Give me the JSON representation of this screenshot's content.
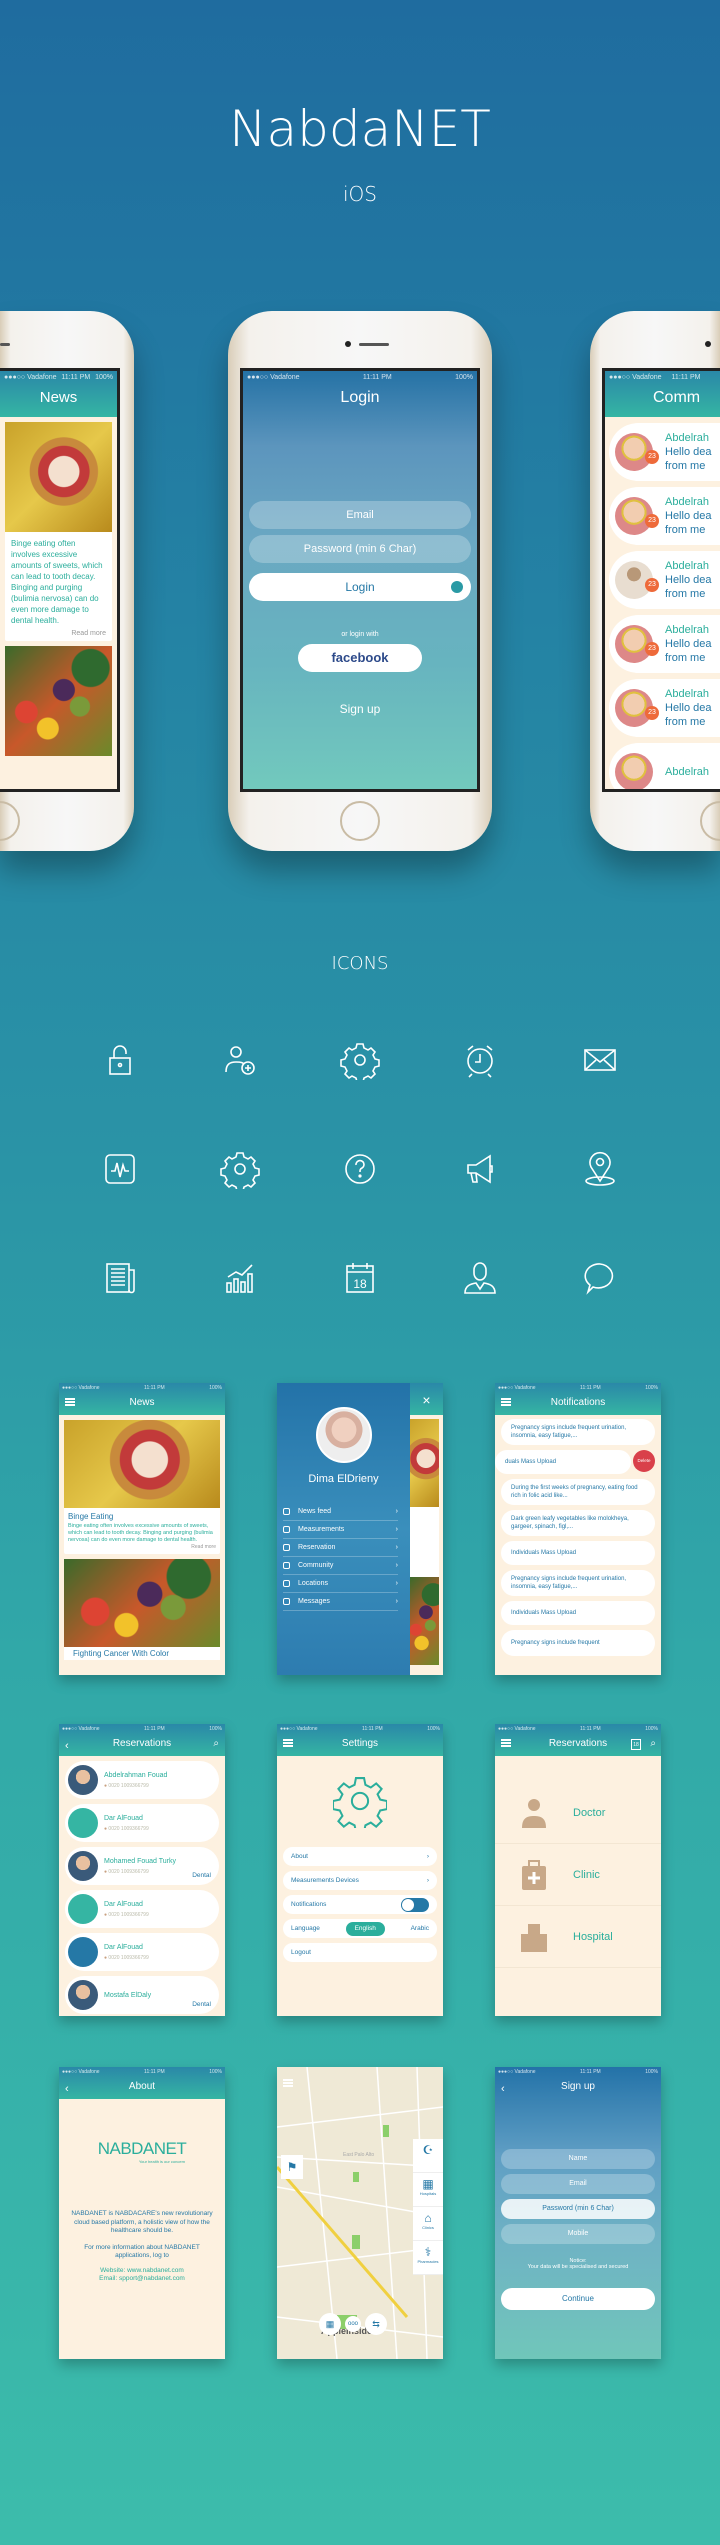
{
  "header": {
    "title": "NabdaNET",
    "subtitle": "iOS"
  },
  "status": {
    "carrier": "●●●○○ Vadafone",
    "time": "11:11 PM",
    "battery": "100%"
  },
  "colors": {
    "teal": "#35b5a3",
    "blue": "#2578a6",
    "cream": "#fdf1e0",
    "delete": "#d9404a",
    "badge": "#ee6a3a"
  },
  "login": {
    "title": "Login",
    "email_placeholder": "Email",
    "password_placeholder": "Password (min 6 Char)",
    "login_button": "Login",
    "or_text": "or login with",
    "facebook": "facebook",
    "signup": "Sign up"
  },
  "community": {
    "title": "Comm",
    "items": [
      {
        "name": "Abdelrah",
        "line1": "Hello dea",
        "line2": "from me",
        "badge": "23"
      },
      {
        "name": "Abdelrah",
        "line1": "Hello dea",
        "line2": "from me",
        "badge": "23"
      },
      {
        "name": "Abdelrah",
        "line1": "Hello dea",
        "line2": "from me",
        "badge": "23"
      },
      {
        "name": "Abdelrah",
        "line1": "Hello dea",
        "line2": "from me",
        "badge": "23"
      },
      {
        "name": "Abdelrah",
        "line1": "Hello dea",
        "line2": "from me",
        "badge": "23"
      },
      {
        "name": "Abdelrah",
        "line1": "",
        "line2": "",
        "badge": ""
      }
    ]
  },
  "icons_section": {
    "title": "ICONS",
    "icons": [
      "lock-icon",
      "add-user-icon",
      "gear-icon",
      "alarm-clock-icon",
      "envelope-icon",
      "pulse-icon",
      "gear-icon",
      "help-icon",
      "megaphone-icon",
      "location-pin-icon",
      "newspaper-icon",
      "chart-icon",
      "calendar-icon",
      "doctor-icon",
      "chat-bubble-icon"
    ],
    "calendar_day": "18"
  },
  "news": {
    "title": "News",
    "articles": [
      {
        "title": "Binge Eating",
        "body": "Binge eating often involves excessive amounts of sweets, which can lead to tooth decay. Binging and purging (bulimia nervosa) can do even more damage to dental health.",
        "read_more": "Read more"
      },
      {
        "title": "Fighting Cancer With Color"
      }
    ]
  },
  "menu": {
    "user_name": "Dima ElDrieny",
    "close": "×",
    "items": [
      {
        "label": "News feed",
        "icon": "newspaper-icon"
      },
      {
        "label": "Measurements",
        "icon": "chart-icon"
      },
      {
        "label": "Reservation",
        "icon": "calendar-icon"
      },
      {
        "label": "Community",
        "icon": "chat-bubble-icon"
      },
      {
        "label": "Locations",
        "icon": "location-pin-icon"
      },
      {
        "label": "Messages",
        "icon": "envelope-icon"
      }
    ]
  },
  "notifications": {
    "title": "Notifications",
    "delete": "Delete",
    "items": [
      "Pregnancy signs include frequent urination, insomnia, easy fatigue,...",
      "duals Mass Upload",
      "During the first weeks of pregnancy, eating food rich in folic acid like...",
      "Dark green leafy vegetables like molokheya, gargeer, spinach, figl,...",
      "Individuals Mass Upload",
      "Pregnancy signs include frequent urination, insomnia, easy fatigue,...",
      "Individuals Mass Upload",
      "Pregnancy signs include frequent"
    ]
  },
  "reservations": {
    "title": "Reservations",
    "items": [
      {
        "name": "Abdelrahman Fouad",
        "phone": "0020 1009366799",
        "tag": "",
        "avatar": "photo"
      },
      {
        "name": "Dar AlFouad",
        "phone": "0020 1009366799",
        "tag": "",
        "avatar": "hospital"
      },
      {
        "name": "Mohamed Fouad Turky",
        "phone": "0020 1009366799",
        "tag": "Dental",
        "avatar": "photo"
      },
      {
        "name": "Dar AlFouad",
        "phone": "0020 1009366799",
        "tag": "",
        "avatar": "hospital"
      },
      {
        "name": "Dar AlFouad",
        "phone": "0020 1009366799",
        "tag": "",
        "avatar": "clinic"
      },
      {
        "name": "Mostafa ElDaly",
        "phone": "",
        "tag": "Dental",
        "avatar": "photo"
      }
    ]
  },
  "settings": {
    "title": "Settings",
    "about": "About",
    "devices": "Measurements Devices",
    "notifications": "Notifications",
    "notifications_on": true,
    "language": "Language",
    "lang_english": "English",
    "lang_arabic": "Arabic",
    "selected_language": "English",
    "logout": "Logout"
  },
  "categories": {
    "title": "Reservations",
    "calendar_day": "18",
    "items": [
      {
        "label": "Doctor",
        "icon": "doctor-icon"
      },
      {
        "label": "Clinic",
        "icon": "first-aid-kit-icon"
      },
      {
        "label": "Hospital",
        "icon": "hospital-icon"
      }
    ]
  },
  "about": {
    "title": "About",
    "logo": "NABDANET",
    "tagline": "Your health is our concern",
    "para1": "NABDANET is NABDACARE's new revolutionary cloud based platform, a holistic view of how the healthcare should be.",
    "para2": "For more information about NABDANET applications, log to",
    "website": "Website: www.nabdanet.com",
    "email": "Email: spport@nabdanet.com"
  },
  "map": {
    "area_label": "East Palo Alto",
    "side": [
      {
        "label": "",
        "icon": "crescent-plus-icon"
      },
      {
        "label": "Hospitals",
        "icon": "hospital-icon"
      },
      {
        "label": "Clinics",
        "icon": "clinic-icon"
      },
      {
        "label": "Pharmacies",
        "icon": "caduceus-icon"
      }
    ],
    "watermark": "AppleInsider"
  },
  "signup": {
    "title": "Sign up",
    "fields": [
      "Name",
      "Email",
      "Password (min 6 Char)",
      "Mobile"
    ],
    "notice_title": "Notice:",
    "notice": "Your data will be specialised and secured",
    "continue": "Continue"
  }
}
